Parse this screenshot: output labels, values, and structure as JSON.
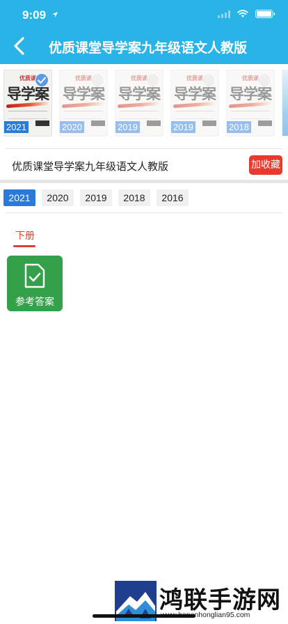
{
  "status_bar": {
    "time": "9:09"
  },
  "header": {
    "title": "优质课堂导学案九年级语文人教版",
    "back_icon": "chevron-left-icon"
  },
  "covers": [
    {
      "top": "优质课",
      "main": "导学案",
      "year": "2021",
      "selected": true
    },
    {
      "top": "优质课",
      "main": "导学案",
      "year": "2020",
      "selected": false
    },
    {
      "top": "优质课",
      "main": "导学案",
      "year": "2019",
      "selected": false
    },
    {
      "top": "优质课",
      "main": "导学案",
      "year": "2019",
      "selected": false
    },
    {
      "top": "优质课",
      "main": "导学案",
      "year": "2018",
      "selected": false
    }
  ],
  "book": {
    "title": "优质课堂导学案九年级语文人教版",
    "favorite_label": "加收藏"
  },
  "year_tabs": [
    {
      "label": "2021",
      "active": true
    },
    {
      "label": "2020",
      "active": false
    },
    {
      "label": "2019",
      "active": false
    },
    {
      "label": "2018",
      "active": false
    },
    {
      "label": "2016",
      "active": false
    }
  ],
  "volume_tab": {
    "label": "下册",
    "active": true
  },
  "answer": {
    "label": "参考答案",
    "icon": "document-check-icon"
  },
  "watermark": {
    "brand": "鸿联手游网",
    "url": "www.henanhonglian95.com"
  },
  "colors": {
    "header": "#29b3e6",
    "accent_blue": "#2a7ad8",
    "accent_red": "#e8392f",
    "answer_green": "#34a04a"
  }
}
